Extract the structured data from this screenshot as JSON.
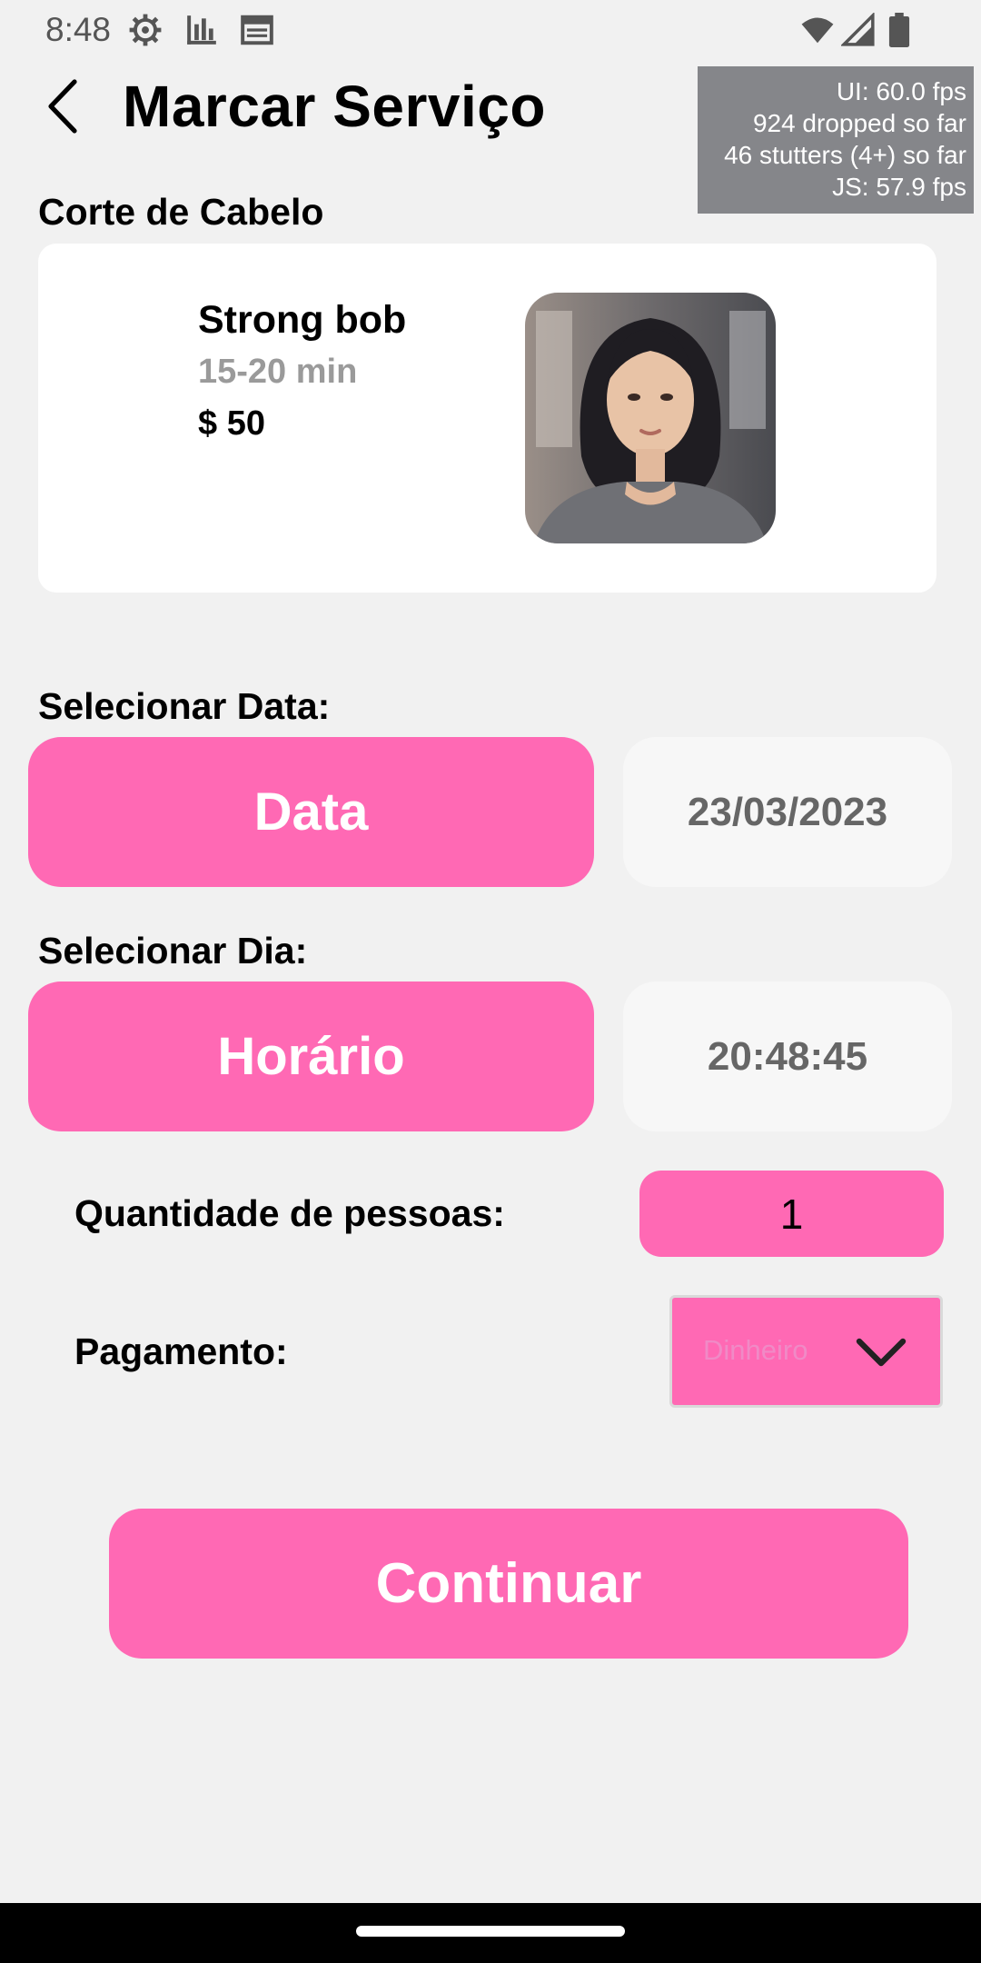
{
  "status_bar": {
    "time": "8:48",
    "icons": [
      "settings-icon",
      "bar-chart-icon",
      "calendar-icon",
      "wifi-icon",
      "signal-icon",
      "battery-icon"
    ]
  },
  "header": {
    "title": "Marcar Serviço",
    "back_icon": "chevron-left-icon"
  },
  "perf_monitor": {
    "ui_fps": "UI: 60.0 fps",
    "dropped": "924 dropped so far",
    "stutters": "46 stutters (4+) so far",
    "js_fps": "JS: 57.9 fps"
  },
  "service": {
    "category": "Corte de Cabelo",
    "name": "Strong bob",
    "duration": "15-20 min",
    "price": "$ 50"
  },
  "date_section": {
    "label": "Selecionar Data:",
    "button_label": "Data",
    "value": "23/03/2023"
  },
  "time_section": {
    "label": "Selecionar Dia:",
    "button_label": "Horário",
    "value": "20:48:45"
  },
  "quantity": {
    "label": "Quantidade de pessoas:",
    "value": "1"
  },
  "payment": {
    "label": "Pagamento:",
    "selected": "Dinheiro",
    "icon": "chevron-down-icon"
  },
  "continue_label": "Continuar",
  "colors": {
    "accent": "#ff69b4",
    "background": "#f1f1f1",
    "card": "#ffffff",
    "value_box": "#f7f7f7",
    "muted_text": "#9a9a9a"
  }
}
